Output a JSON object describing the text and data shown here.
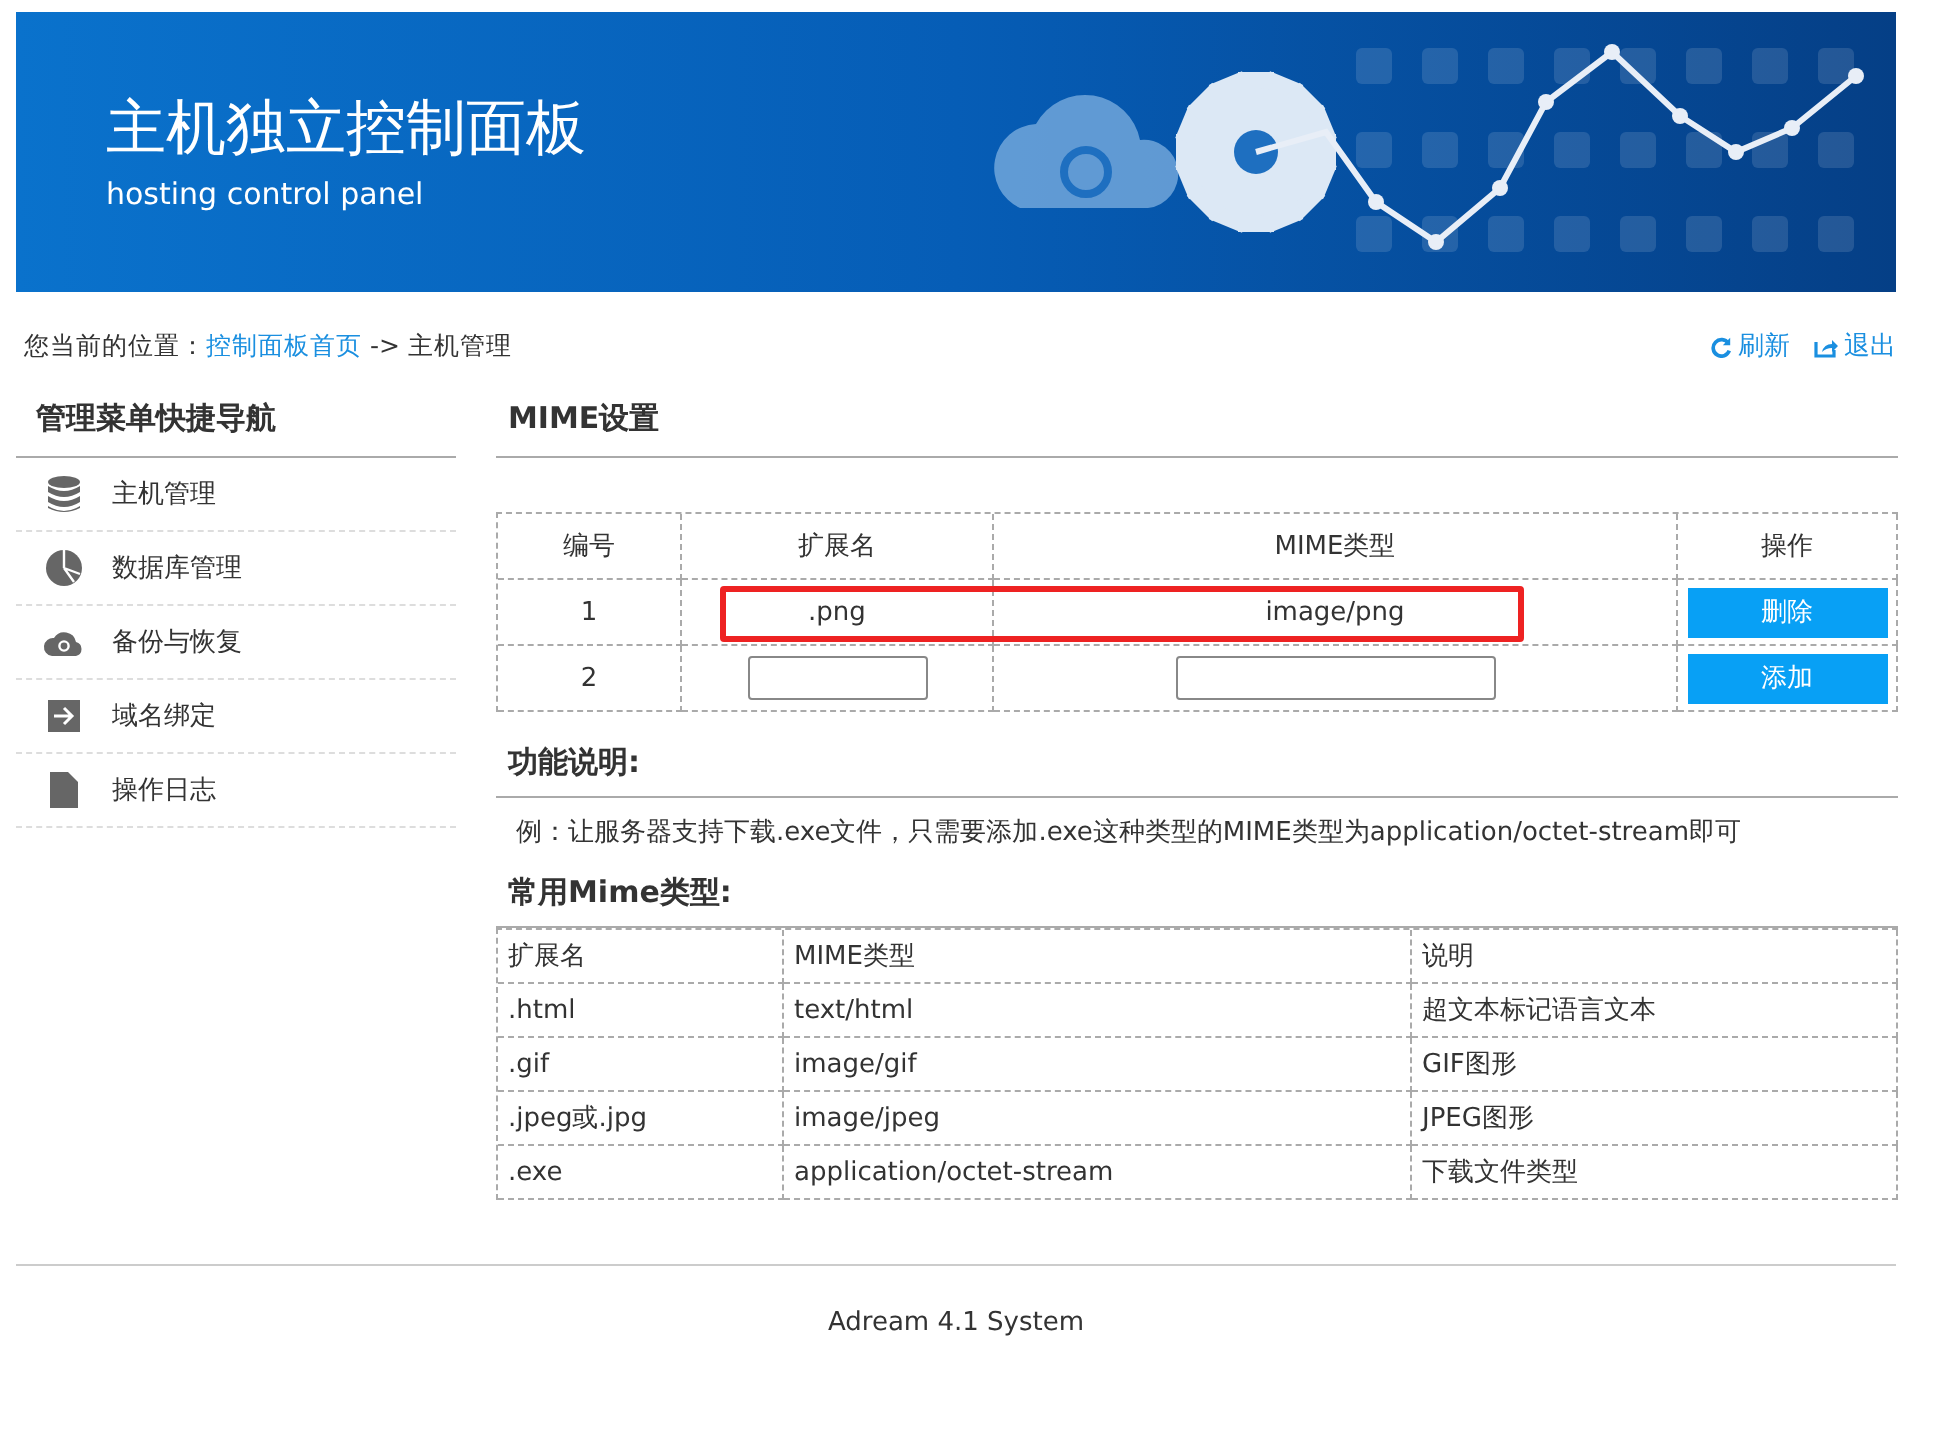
{
  "header": {
    "title": "主机独立控制面板",
    "subtitle": "hosting control panel"
  },
  "breadcrumb": {
    "prefix": "您当前的位置：",
    "link": "控制面板首页",
    "separator": "->",
    "current": "主机管理"
  },
  "top_actions": [
    {
      "kind": "refresh",
      "label": "刷新"
    },
    {
      "kind": "logout",
      "label": "退出"
    }
  ],
  "sidebar": {
    "title": "管理菜单快捷导航",
    "items": [
      {
        "kind": "database",
        "label": "主机管理"
      },
      {
        "kind": "pie",
        "label": "数据库管理"
      },
      {
        "kind": "cloud",
        "label": "备份与恢复"
      },
      {
        "kind": "enter",
        "label": "域名绑定"
      },
      {
        "kind": "file",
        "label": "操作日志"
      }
    ]
  },
  "main": {
    "title": "MIME设置",
    "mime_table": {
      "columns": [
        "编号",
        "扩展名",
        "MIME类型",
        "操作"
      ],
      "rows": [
        {
          "kind": "existing",
          "number": "1",
          "extension": ".png",
          "mime": "image/png",
          "action": "删除",
          "highlighted": true
        },
        {
          "kind": "new",
          "number": "2",
          "action": "添加",
          "highlighted": false
        }
      ]
    },
    "help_title": "功能说明:",
    "help_text": "例：让服务器支持下载.exe文件，只需要添加.exe这种类型的MIME类型为application/octet-stream即可",
    "common_title": "常用Mime类型:",
    "common_table": {
      "columns": [
        "扩展名",
        "MIME类型",
        "说明"
      ],
      "rows": [
        [
          ".html",
          "text/html",
          "超文本标记语言文本"
        ],
        [
          ".gif",
          "image/gif",
          "GIF图形"
        ],
        [
          ".jpeg或.jpg",
          "image/jpeg",
          "JPEG图形"
        ],
        [
          ".exe",
          "application/octet-stream",
          "下载文件类型"
        ]
      ]
    }
  },
  "footer": "Adream 4.1 System"
}
